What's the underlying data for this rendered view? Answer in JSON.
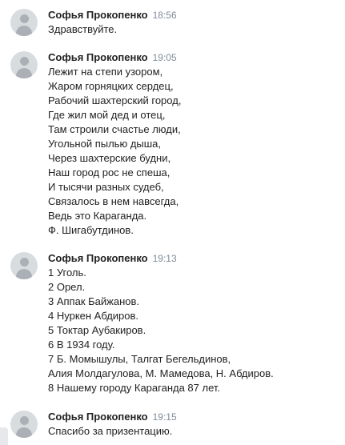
{
  "messages": [
    {
      "author": "Софья Прокопенко",
      "time": "18:56",
      "lines": [
        "Здравствуйте."
      ]
    },
    {
      "author": "Софья Прокопенко",
      "time": "19:05",
      "lines": [
        "Лежит на степи узором,",
        "Жаром горняцких сердец,",
        "Рабочий шахтерский город,",
        "Где жил мой дед и отец,",
        "Там строили счастье люди,",
        "Угольной пылью дыша,",
        "Через шахтерские будни,",
        "Наш город рос не спеша,",
        "И тысячи разных судеб,",
        "Связалось в нем навсегда,",
        "Ведь это Караганда.",
        "Ф. Шигабутдинов."
      ]
    },
    {
      "author": "Софья Прокопенко",
      "time": "19:13",
      "lines": [
        "1 Уголь.",
        "2 Орел.",
        "3 Аппак Байжанов.",
        "4 Нуркен Абдиров.",
        "5 Токтар Аубакиров.",
        "6 В 1934 году.",
        "7 Б. Момышулы, Талгат Бегельдинов,",
        "Алия Молдагулова, М. Мамедова, Н. Абдиров.",
        "8 Нашему городу Караганда 87 лет."
      ]
    },
    {
      "author": "Софья Прокопенко",
      "time": "19:15",
      "lines": [
        "Спасибо за призентацию."
      ]
    }
  ]
}
